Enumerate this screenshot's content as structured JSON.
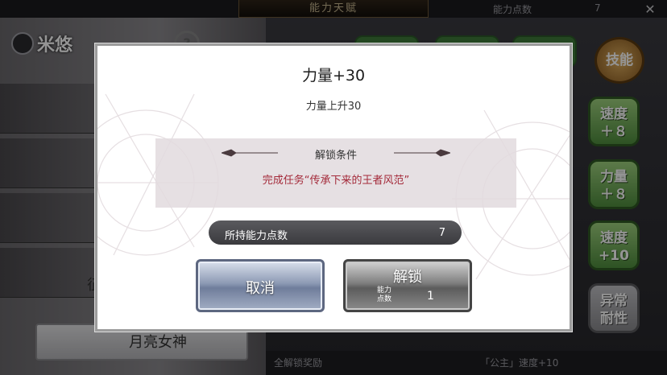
{
  "background": {
    "top_title": "能力天赋",
    "top_right_label": "能力点数",
    "top_right_value": "7",
    "close_glyph": "✕",
    "character_name": "米悠",
    "help_glyph": "?",
    "partial_label": "征",
    "selected_character": "月亮女神",
    "skill_badge": "技能",
    "side_badges": [
      {
        "line1": "速度",
        "line2": "＋８"
      },
      {
        "line1": "力量",
        "line2": "＋８"
      },
      {
        "line1": "速度",
        "line2": "+10"
      },
      {
        "line1": "异常",
        "line2": "耐性"
      }
    ],
    "bottom_left": "全解锁奖励",
    "bottom_right": "「公主」速度+10"
  },
  "dialog": {
    "title": "力量+30",
    "subtitle": "力量上升30",
    "condition_header": "解锁条件",
    "condition_text": "完成任务“传承下来的王者风范”",
    "points_label": "所持能力点数",
    "points_value": "7",
    "cancel_label": "取消",
    "unlock_label": "解锁",
    "cost_label": "能力\n点数",
    "cost_value": "1"
  },
  "colors": {
    "condition_text": "#a42a3a",
    "cancel_button": "#8d9ab4",
    "unlock_button": "#7e7e7e",
    "badge_green": "#4f8e3e"
  }
}
